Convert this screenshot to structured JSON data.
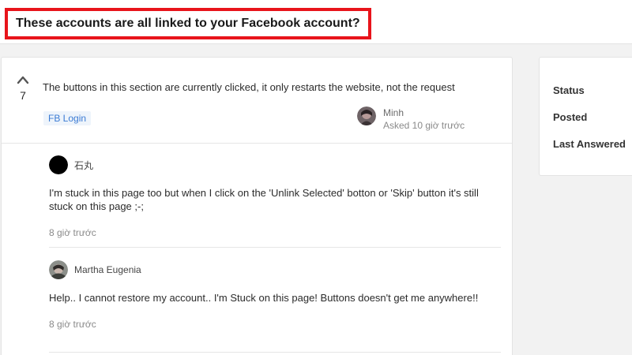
{
  "title": "These accounts are all linked to your Facebook account?",
  "question": {
    "votes": "7",
    "text": "The buttons in this section are currently clicked, it only restarts the website, not the request",
    "tag": "FB Login",
    "asker": {
      "name": "Minh",
      "time": "Asked 10 giờ trước"
    }
  },
  "comments": [
    {
      "author": "石丸",
      "text": "I'm stuck in this page too but when I click on the 'Unlink Selected' botton or 'Skip' button it's still stuck on this page ;-;",
      "time": "8 giờ trước",
      "avatar": "black-circle"
    },
    {
      "author": "Martha Eugenia",
      "text": "Help.. I cannot restore my account.. I'm Stuck on this page! Buttons doesn't get me anywhere!!",
      "time": "8 giờ trước",
      "avatar": "photo"
    }
  ],
  "sidebar": {
    "status_label": "Status",
    "posted_label": "Posted",
    "last_answered_label": "Last Answered"
  },
  "colors": {
    "highlight_border": "#e8141b",
    "tag_text": "#3b7bd4",
    "tag_bg": "#eef4fb"
  },
  "icons": {
    "upvote": "chevron-up-icon"
  }
}
